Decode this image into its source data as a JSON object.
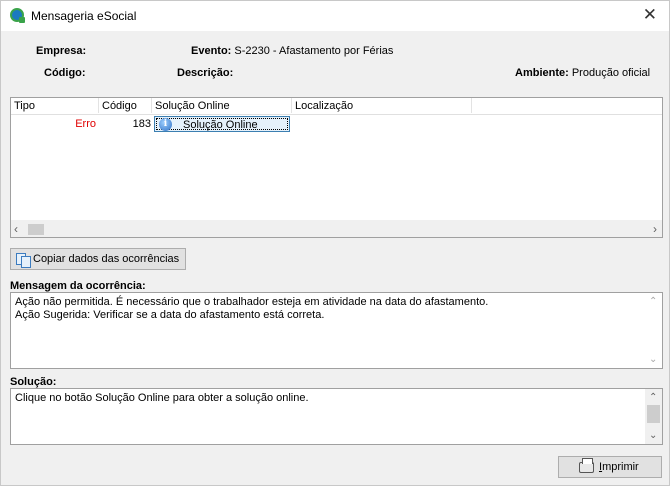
{
  "window": {
    "title": "Mensageria eSocial",
    "close_glyph": "✕"
  },
  "info": {
    "empresa_label": "Empresa:",
    "empresa_value": "",
    "codigo_label": "Código:",
    "codigo_value": "",
    "evento_label": "Evento:",
    "evento_value": "S-2230 - Afastamento por Férias",
    "descricao_label": "Descrição:",
    "descricao_value": "",
    "ambiente_label": "Ambiente:",
    "ambiente_value": "Produção oficial"
  },
  "grid": {
    "columns": [
      "Tipo",
      "Código",
      "Solução Online",
      "Localização"
    ],
    "rows": [
      {
        "tipo": "Erro",
        "codigo": "183",
        "solucao_button": "Solução Online",
        "localizacao": ""
      }
    ],
    "colors": {
      "erro": "#e00000"
    }
  },
  "buttons": {
    "copy": "Copiar dados das ocorrências",
    "print_first": "I",
    "print_rest": "mprimir"
  },
  "mensagem": {
    "label": "Mensagem da ocorrência:",
    "line1": "Ação não permitida. É necessário que o trabalhador esteja em atividade na data do afastamento.",
    "line2": "Ação Sugerida: Verificar se a data do afastamento está correta."
  },
  "solucao": {
    "label": "Solução:",
    "text": "Clique no botão Solução Online para obter a solução online."
  },
  "icons": [
    "app-icon",
    "close-icon",
    "info-icon",
    "copy-icon",
    "printer-icon"
  ]
}
